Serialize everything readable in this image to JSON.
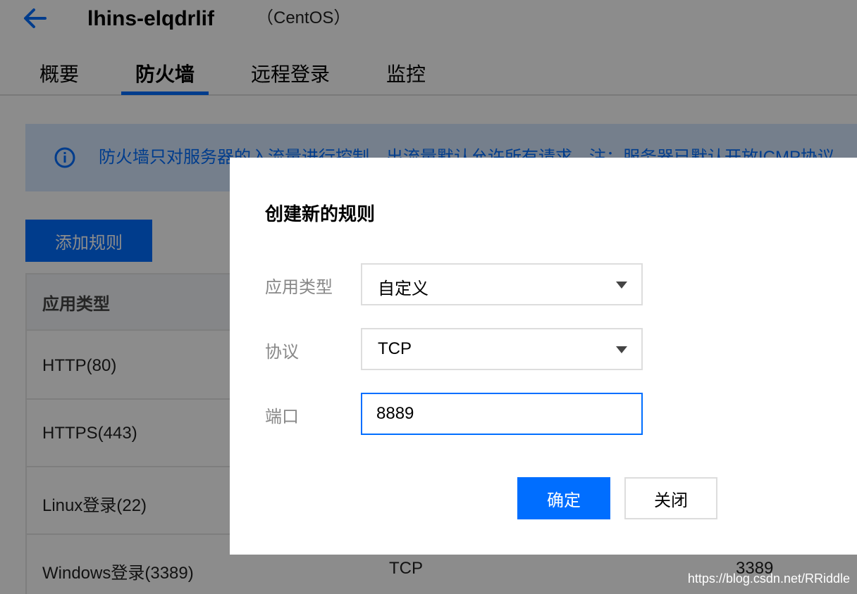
{
  "header": {
    "instance_name": "lhins-elqdrlif",
    "os_label": "（CentOS）",
    "back_icon": "arrow-left-icon"
  },
  "tabs": [
    {
      "label": "概要",
      "active": false
    },
    {
      "label": "防火墙",
      "active": true
    },
    {
      "label": "远程登录",
      "active": false
    },
    {
      "label": "监控",
      "active": false
    }
  ],
  "notice": {
    "icon": "info-circle-icon",
    "text": "防火墙只对服务器的入流量进行控制，出流量默认允许所有请求。注：服务器已默认开放ICMP协议"
  },
  "toolbar": {
    "add_rule_label": "添加规则"
  },
  "rules_table": {
    "header_app_type": "应用类型",
    "rows": [
      {
        "name": "HTTP(80)",
        "protocol": "",
        "port": ""
      },
      {
        "name": "HTTPS(443)",
        "protocol": "",
        "port": ""
      },
      {
        "name": "Linux登录(22)",
        "protocol": "",
        "port": ""
      },
      {
        "name": "Windows登录(3389)",
        "protocol": "TCP",
        "port": "3389"
      }
    ]
  },
  "dialog": {
    "title": "创建新的规则",
    "app_type_label": "应用类型",
    "app_type_value": "自定义",
    "protocol_label": "协议",
    "protocol_value": "TCP",
    "port_label": "端口",
    "port_value": "8889",
    "confirm_label": "确定",
    "close_label": "关闭"
  },
  "watermark": "https://blog.csdn.net/RRiddle",
  "colors": {
    "accent": "#006eff",
    "notice_bg": "#d5e7ff",
    "overlay": "rgba(0,0,0,0.45)"
  }
}
